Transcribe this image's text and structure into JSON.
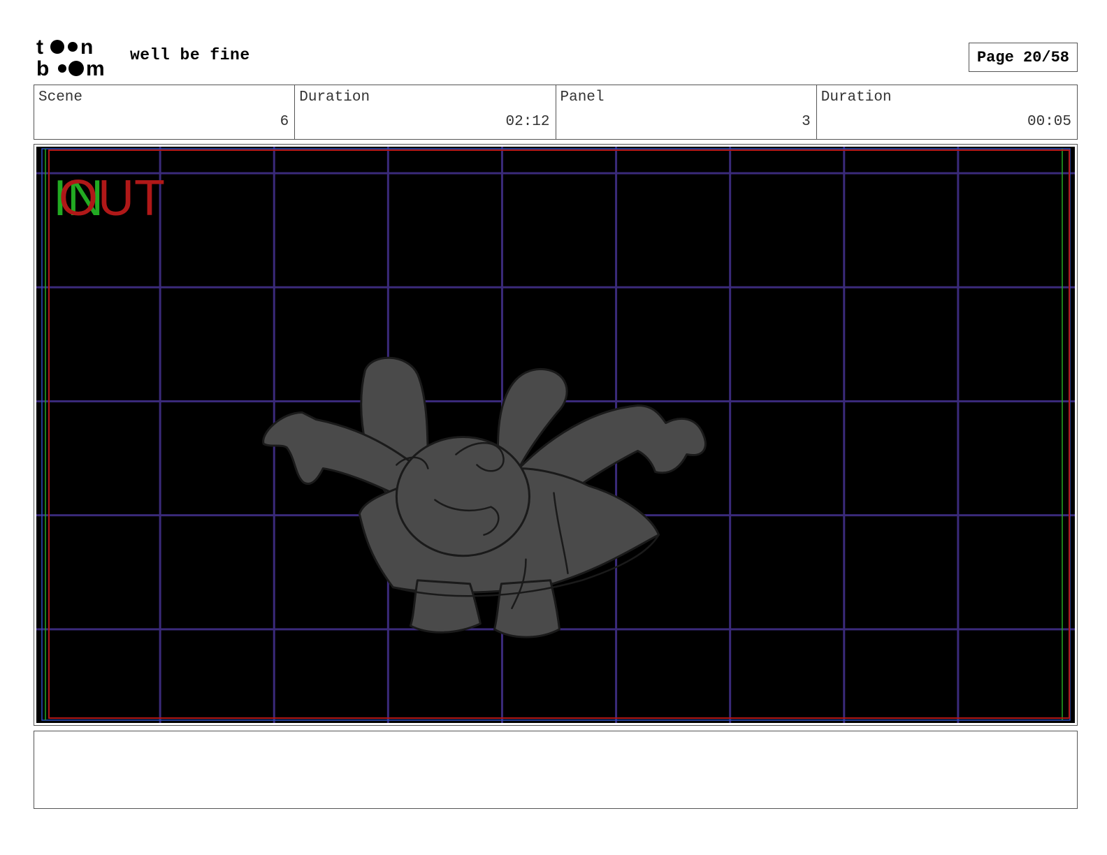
{
  "header": {
    "logo": {
      "line1": "toon",
      "line2": "boom",
      "icon": "toon-boom-logo"
    },
    "project_title": "well be fine",
    "page_label": "Page 20/58"
  },
  "info": {
    "scene_label": "Scene",
    "scene_value": "6",
    "scene_duration_label": "Duration",
    "scene_duration_value": "02:12",
    "panel_label": "Panel",
    "panel_value": "3",
    "panel_duration_label": "Duration",
    "panel_duration_value": "00:05"
  },
  "panel": {
    "in_marker": "IN",
    "out_marker": "OUT",
    "colors": {
      "background": "#000000",
      "grid": "#3a2a7a",
      "in": "#22aa22",
      "out": "#b01818",
      "sketch_fill": "#4a4a4a",
      "sketch_line": "#1a1a1a"
    },
    "icon": "character-sketch"
  },
  "notes": {
    "text": ""
  }
}
